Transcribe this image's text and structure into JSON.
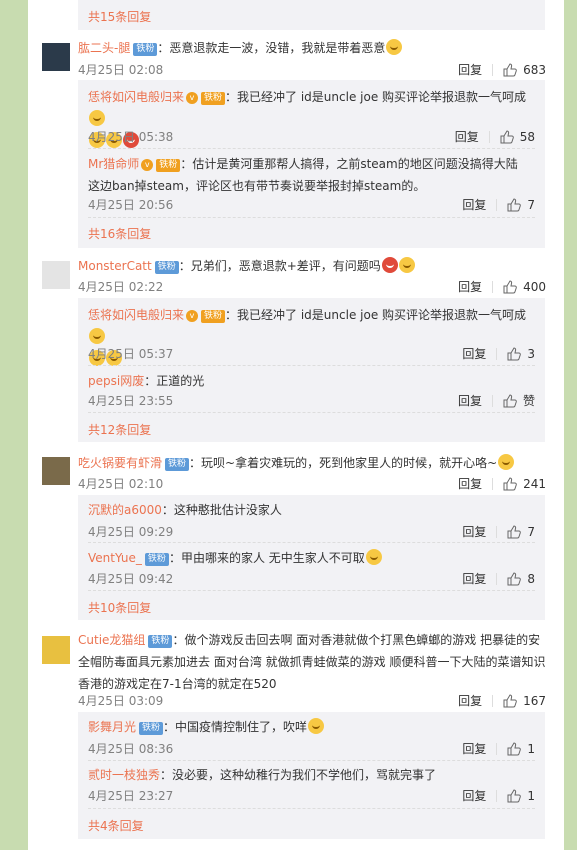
{
  "top_more": "共15条回复",
  "comments": [
    {
      "user": "肱二头-腿",
      "badge": "铁粉",
      "text": "：恶意退款走一波，没错，我就是带着恶意",
      "time": "4月25日 02:08",
      "reply": "回复",
      "likes": "683",
      "avatar_color": "#2b3a4a",
      "subs": [
        {
          "user": "恁将如闪电般归来",
          "badge": "铁粉",
          "text": "：我已经冲了 id是uncle joe 购买评论举报退款一气呵成",
          "time": "4月25日 05:38",
          "reply": "回复",
          "likes": "58"
        },
        {
          "user": "Mr猎命师",
          "badge": "铁粉",
          "text": "：估计是黄河重那帮人搞得，之前steam的地区问题没搞得大陆这边ban掉steam，评论区也有带节奏说要举报封掉steam的。",
          "time": "4月25日 20:56",
          "reply": "回复",
          "likes": "7"
        }
      ],
      "more": "共16条回复"
    },
    {
      "user": "MonsterCatt",
      "badge": "铁粉",
      "text": "：兄弟们，恶意退款+差评，有问题吗",
      "time": "4月25日 02:22",
      "reply": "回复",
      "likes": "400",
      "avatar_color": "#666666",
      "subs": [
        {
          "user": "恁将如闪电般归来",
          "badge": "铁粉",
          "text": "：我已经冲了 id是uncle joe 购买评论举报退款一气呵成",
          "time": "4月25日 05:37",
          "reply": "回复",
          "likes": "3"
        },
        {
          "user": "pepsi网废",
          "badge": "",
          "text": "：正道的光",
          "time": "4月25日 23:55",
          "reply": "回复",
          "likes": "赞"
        }
      ],
      "more": "共12条回复"
    },
    {
      "user": "吃火锅要有虾滑",
      "badge": "铁粉",
      "text": "：玩呗~拿着灾难玩的，死到他家里人的时候，就开心咯~",
      "time": "4月25日 02:10",
      "reply": "回复",
      "likes": "241",
      "avatar_color": "#7a6a4a",
      "subs": [
        {
          "user": "沉默的a6000",
          "badge": "",
          "text": "：这种憨批估计没家人",
          "time": "4月25日 09:29",
          "reply": "回复",
          "likes": "7"
        },
        {
          "user": "VentYue_",
          "badge": "铁粉",
          "text": "：甲由哪来的家人 无中生家人不可取",
          "time": "4月25日 09:42",
          "reply": "回复",
          "likes": "8"
        }
      ],
      "more": "共10条回复"
    },
    {
      "user": "Cutie龙猫组",
      "badge": "铁粉",
      "text": "：做个游戏反击回去啊  面对香港就做个打黑色蟑螂的游戏  把暴徒的安全帽防毒面具元素加进去    面对台湾 就做抓青蛙做菜的游戏 顺便科普一下大陆的菜谱知识  香港的游戏定在7-1台湾的就定在520",
      "time": "4月25日 03:09",
      "reply": "回复",
      "likes": "167",
      "avatar_color": "#e8c040",
      "subs": [
        {
          "user": "影舞月光",
          "badge": "铁粉",
          "text": "：中国疫情控制住了，吹咩",
          "time": "4月25日 08:36",
          "reply": "回复",
          "likes": "1"
        },
        {
          "user": "贰时一枝独秀",
          "badge": "",
          "text": "：没必要，这种幼稚行为我们不学他们，骂就完事了",
          "time": "4月25日 23:27",
          "reply": "回复",
          "likes": "1"
        }
      ],
      "more": "共4条回复"
    }
  ]
}
